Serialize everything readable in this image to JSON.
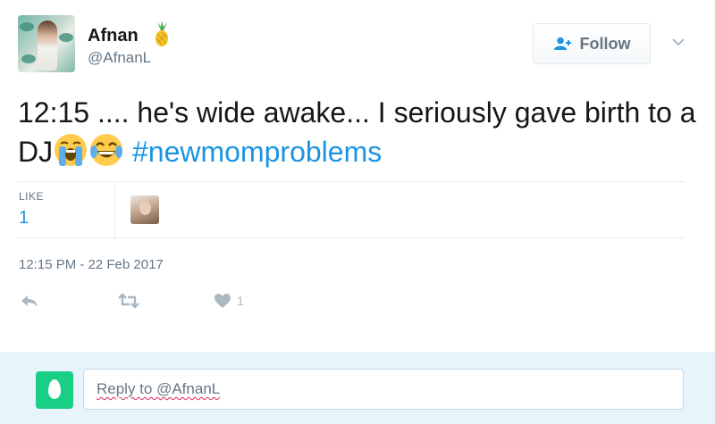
{
  "author": {
    "name": "Afnan",
    "handle": "@AfnanL",
    "name_emoji_icon": "pineapple-icon"
  },
  "follow_button": {
    "label": "Follow",
    "icon": "add-user-icon"
  },
  "tweet": {
    "text": "12:15 .... he's wide awake... I seriously gave birth to a DJ",
    "emojis": [
      "loudly-crying-face-icon",
      "face-with-tears-of-joy-icon"
    ],
    "hashtag": "#newmomproblems"
  },
  "stats": {
    "like_label": "LIKE",
    "like_count": "1"
  },
  "timestamp": "12:15 PM - 22 Feb 2017",
  "actions": {
    "reply_icon": "reply-icon",
    "retweet_icon": "retweet-icon",
    "like_icon": "heart-icon",
    "like_count": "1"
  },
  "reply": {
    "placeholder": "Reply to @AfnanL"
  },
  "colors": {
    "link_blue": "#1b95e0",
    "secondary_text": "#657786",
    "reply_bar_bg": "#e8f4fb",
    "egg_avatar_green": "#19cf86"
  }
}
